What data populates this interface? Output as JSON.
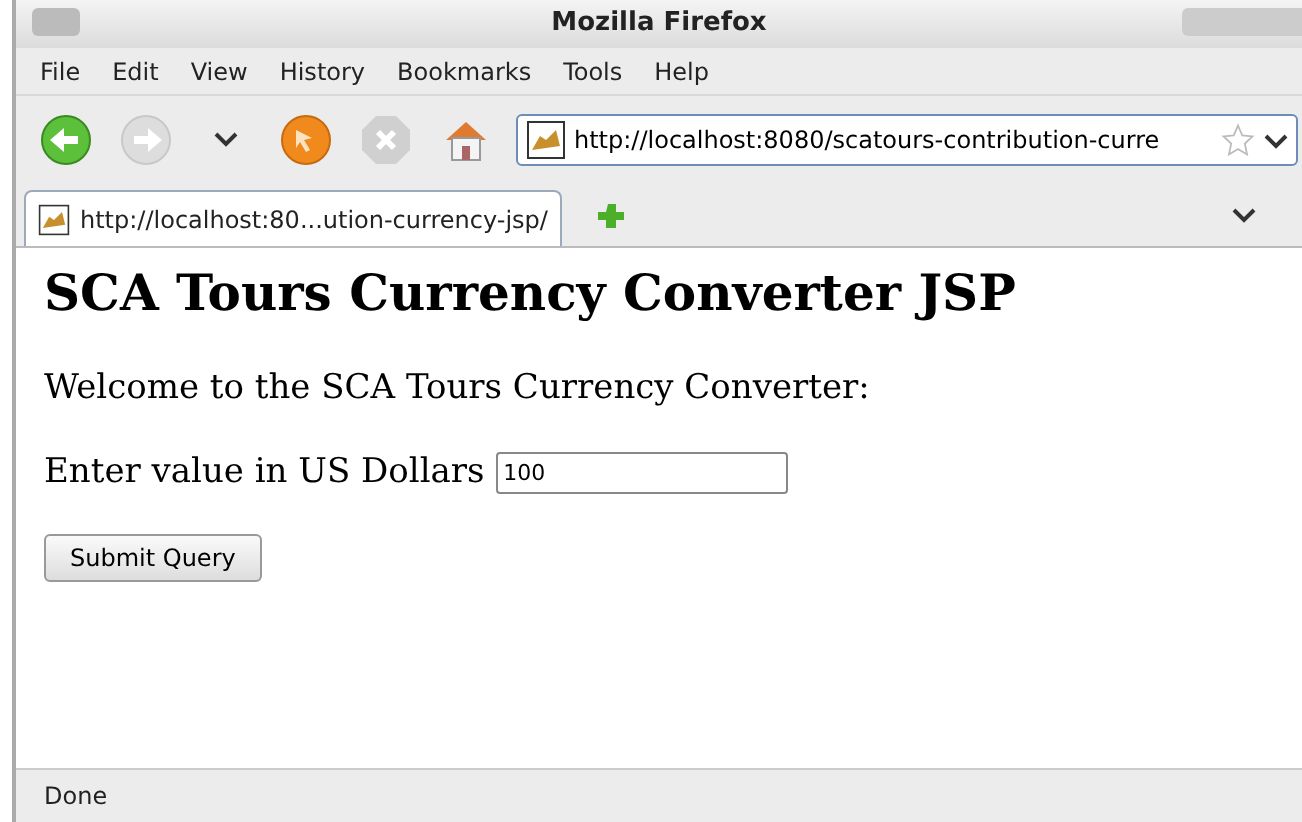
{
  "window": {
    "title": "Mozilla Firefox"
  },
  "menu": [
    "File",
    "Edit",
    "View",
    "History",
    "Bookmarks",
    "Tools",
    "Help"
  ],
  "toolbar": [
    {
      "kind": "back",
      "disabled": false
    },
    {
      "kind": "forward",
      "disabled": true
    },
    {
      "kind": "history",
      "disabled": false
    },
    {
      "kind": "reload",
      "disabled": false
    },
    {
      "kind": "stop",
      "disabled": true
    },
    {
      "kind": "home",
      "disabled": false
    }
  ],
  "address": {
    "value": "http://localhost:8080/scatours-contribution-curre"
  },
  "tabs": [
    {
      "label": "http://localhost:80...ution-currency-jsp/",
      "selected": true
    }
  ],
  "page": {
    "heading": "SCA Tours Currency Converter JSP",
    "welcome": "Welcome to the SCA Tours Currency Converter:",
    "field_label": "Enter value in US Dollars",
    "field_value": "100",
    "submit": "Submit Query"
  },
  "status_bar": "Done"
}
